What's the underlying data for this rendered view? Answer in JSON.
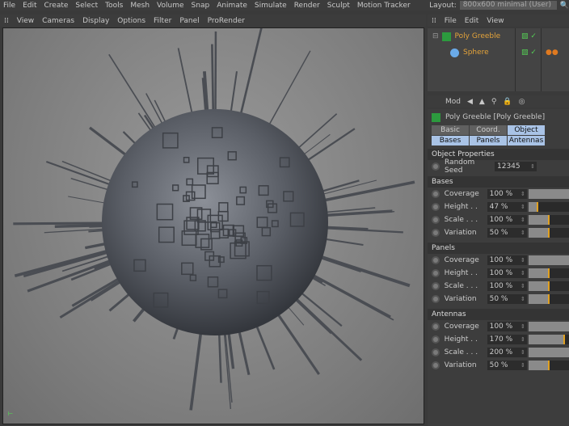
{
  "menu": [
    "File",
    "Edit",
    "Create",
    "Select",
    "Tools",
    "Mesh",
    "Volume",
    "Snap",
    "Animate",
    "Simulate",
    "Render",
    "Sculpt",
    "Motion Tracker"
  ],
  "layout": {
    "label": "Layout:",
    "value": "800x600 minimal (User)"
  },
  "viewport_menu": [
    "View",
    "Cameras",
    "Display",
    "Options",
    "Filter",
    "Panel",
    "ProRender"
  ],
  "object_manager": {
    "menu": [
      "File",
      "Edit",
      "View"
    ],
    "objects": [
      {
        "name": "Poly Greeble",
        "icon": "greeble-icon"
      },
      {
        "name": "Sphere",
        "icon": "sphere-icon"
      }
    ]
  },
  "attributes": {
    "mode_label": "Mod",
    "object_title": "Poly Greeble [Poly Greeble]",
    "tabs": [
      {
        "label": "Basic",
        "active": false
      },
      {
        "label": "Coord.",
        "active": false
      },
      {
        "label": "Object",
        "active": true
      },
      {
        "label": "Bases",
        "active": true
      },
      {
        "label": "Panels",
        "active": true
      },
      {
        "label": "Antennas",
        "active": true
      }
    ],
    "object_properties": "Object Properties",
    "random_seed": {
      "label": "Random Seed",
      "value": "12345"
    },
    "sections": [
      {
        "title": "Bases",
        "props": [
          {
            "label": "Coverage",
            "value": "100 %",
            "num": 100,
            "max": 100
          },
          {
            "label": "Height . .",
            "value": "47 %",
            "num": 47,
            "max": 200
          },
          {
            "label": "Scale . . .",
            "value": "100 %",
            "num": 100,
            "max": 200
          },
          {
            "label": "Variation",
            "value": "50 %",
            "num": 50,
            "max": 100
          }
        ]
      },
      {
        "title": "Panels",
        "props": [
          {
            "label": "Coverage",
            "value": "100 %",
            "num": 100,
            "max": 100
          },
          {
            "label": "Height . .",
            "value": "100 %",
            "num": 100,
            "max": 200
          },
          {
            "label": "Scale . . .",
            "value": "100 %",
            "num": 100,
            "max": 200
          },
          {
            "label": "Variation",
            "value": "50 %",
            "num": 50,
            "max": 100
          }
        ]
      },
      {
        "title": "Antennas",
        "props": [
          {
            "label": "Coverage",
            "value": "100 %",
            "num": 100,
            "max": 100
          },
          {
            "label": "Height . .",
            "value": "170 %",
            "num": 170,
            "max": 200
          },
          {
            "label": "Scale . . .",
            "value": "200 %",
            "num": 200,
            "max": 200
          },
          {
            "label": "Variation",
            "value": "50 %",
            "num": 50,
            "max": 100
          }
        ]
      }
    ]
  },
  "colors": {
    "accent": "#e0a020",
    "tab_active": "#a9c3e6"
  }
}
